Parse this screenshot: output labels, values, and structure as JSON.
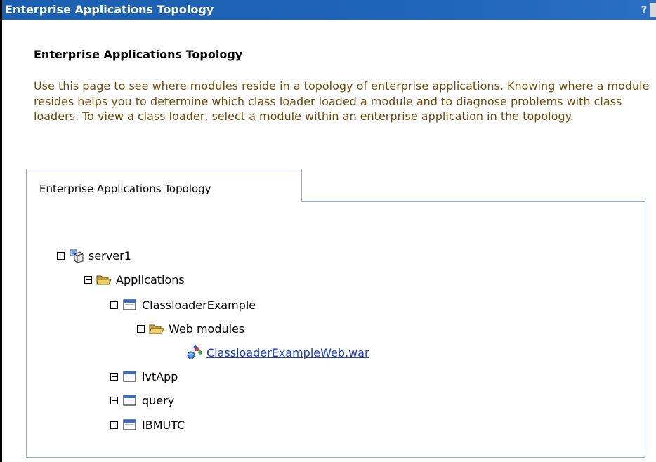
{
  "window": {
    "title": "Enterprise Applications Topology",
    "help_label": "?"
  },
  "page": {
    "title": "Enterprise Applications Topology",
    "description": "Use this page to see where modules reside in a topology of enterprise applications. Knowing where a module resides helps you to determine which class loader loaded a module and to diagnose problems with class loaders. To view a class loader, select a module within an enterprise application in the topology."
  },
  "tab": {
    "label": "Enterprise Applications Topology"
  },
  "tree": {
    "server": {
      "label": "server1",
      "icon": "server-icon",
      "expanded": true
    },
    "applications": {
      "label": "Applications",
      "icon": "folder-open-icon",
      "expanded": true
    },
    "app_classloader": {
      "label": "ClassloaderExample",
      "icon": "application-window-icon",
      "expanded": true
    },
    "web_modules": {
      "label": "Web modules",
      "icon": "folder-open-icon",
      "expanded": true
    },
    "war_module": {
      "label": "ClassloaderExampleWeb.war",
      "icon": "web-module-icon",
      "link": true
    },
    "app_ivt": {
      "label": "ivtApp",
      "icon": "application-window-icon",
      "expanded": false
    },
    "app_query": {
      "label": "query",
      "icon": "application-window-icon",
      "expanded": false
    },
    "app_ibmutc": {
      "label": "IBMUTC",
      "icon": "application-window-icon",
      "expanded": false
    }
  },
  "colors": {
    "titlebar": "#1e64b8",
    "description_text": "#6a4a10",
    "panel_border": "#8eaad6",
    "link": "#1a3ccc"
  }
}
